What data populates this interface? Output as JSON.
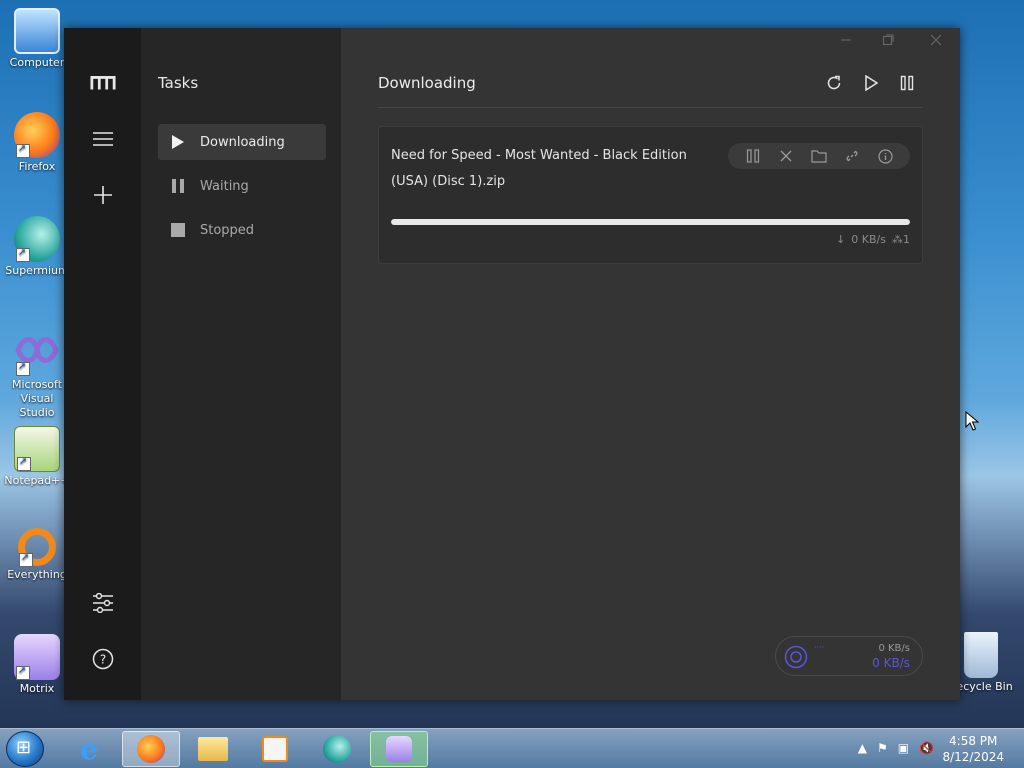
{
  "desktop": {
    "icons": [
      {
        "label": "Computer"
      },
      {
        "label": "Firefox"
      },
      {
        "label": "Supermium"
      },
      {
        "label": "Microsoft Visual Studio"
      },
      {
        "label": "Notepad++"
      },
      {
        "label": "Everything"
      },
      {
        "label": "Motrix"
      },
      {
        "label": "Recycle Bin"
      }
    ]
  },
  "app": {
    "sidebar_title": "Tasks",
    "nav": [
      {
        "label": "Downloading",
        "icon": "play-icon",
        "active": true
      },
      {
        "label": "Waiting",
        "icon": "pause-icon"
      },
      {
        "label": "Stopped",
        "icon": "stop-icon"
      }
    ],
    "main_title": "Downloading",
    "tasks": [
      {
        "name": "Need for Speed - Most Wanted - Black Edition (USA) (Disc 1).zip",
        "progress": 1.0,
        "speed": "0 KB/s",
        "connections": "1"
      }
    ],
    "speed_meter": {
      "upload": "0 KB/s",
      "download": "0 KB/s",
      "label": "····"
    }
  },
  "taskbar": {
    "clock_time": "4:58 PM",
    "clock_date": "8/12/2024"
  },
  "colors": {
    "accent": "#5b55d8",
    "rail": "#1b1b1b",
    "sidebar": "#262626",
    "main": "#343434"
  }
}
